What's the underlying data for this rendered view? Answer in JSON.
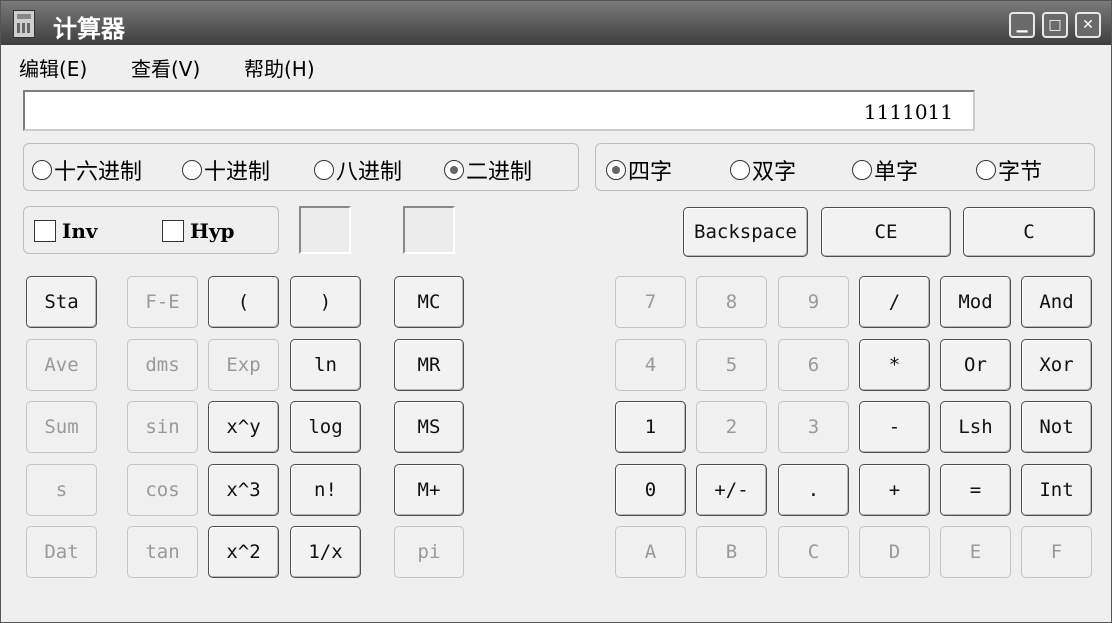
{
  "window": {
    "title": "计算器"
  },
  "menu": [
    "编辑(E)",
    "查看(V)",
    "帮助(H)"
  ],
  "window_controls": [
    "minimize-icon",
    "maximize-icon",
    "close-icon"
  ],
  "display": {
    "value": "1111011"
  },
  "base_modes": [
    {
      "label": "十六进制",
      "checked": false
    },
    {
      "label": "十进制",
      "checked": false
    },
    {
      "label": "八进制",
      "checked": false
    },
    {
      "label": "二进制",
      "checked": true
    }
  ],
  "word_sizes": [
    {
      "label": "四字",
      "checked": true
    },
    {
      "label": "双字",
      "checked": false
    },
    {
      "label": "单字",
      "checked": false
    },
    {
      "label": "字节",
      "checked": false
    }
  ],
  "checkboxes": [
    {
      "label": "Inv",
      "checked": false
    },
    {
      "label": "Hyp",
      "checked": false
    }
  ],
  "edit_keys": [
    "Backspace",
    "CE",
    "C"
  ],
  "keys": {
    "row1": [
      "Sta",
      "F-E",
      "(",
      ")",
      "MC",
      "7",
      "8",
      "9",
      "/",
      "Mod",
      "And"
    ],
    "row2": [
      "Ave",
      "dms",
      "Exp",
      "ln",
      "MR",
      "4",
      "5",
      "6",
      "*",
      "Or",
      "Xor"
    ],
    "row3": [
      "Sum",
      "sin",
      "x^y",
      "log",
      "MS",
      "1",
      "2",
      "3",
      "-",
      "Lsh",
      "Not"
    ],
    "row4": [
      "s",
      "cos",
      "x^3",
      "n!",
      "M+",
      "0",
      "+/-",
      ".",
      "+",
      "=",
      "Int"
    ],
    "row5": [
      "Dat",
      "tan",
      "x^2",
      "1/x",
      "pi",
      "A",
      "B",
      "C",
      "D",
      "E",
      "F"
    ]
  },
  "disabled_keys": {
    "row1": [
      false,
      true,
      false,
      false,
      false,
      true,
      true,
      true,
      false,
      false,
      false
    ],
    "row2": [
      true,
      true,
      true,
      false,
      false,
      true,
      true,
      true,
      false,
      false,
      false
    ],
    "row3": [
      true,
      true,
      false,
      false,
      false,
      false,
      true,
      true,
      false,
      false,
      false
    ],
    "row4": [
      true,
      true,
      false,
      false,
      false,
      false,
      false,
      false,
      false,
      false,
      false
    ],
    "row5": [
      true,
      true,
      false,
      false,
      true,
      true,
      true,
      true,
      true,
      true,
      true
    ]
  },
  "key_names": {
    "row1": [
      "sta",
      "f-e",
      "open-paren",
      "close-paren",
      "mc",
      "7",
      "8",
      "9",
      "divide",
      "mod",
      "and"
    ],
    "row2": [
      "ave",
      "dms",
      "exp",
      "ln",
      "mr",
      "4",
      "5",
      "6",
      "multiply",
      "or",
      "xor"
    ],
    "row3": [
      "sum",
      "sin",
      "x-pow-y",
      "log",
      "ms",
      "1",
      "2",
      "3",
      "minus",
      "lsh",
      "not"
    ],
    "row4": [
      "s",
      "cos",
      "x-cubed",
      "factorial",
      "m-plus",
      "0",
      "sign",
      "decimal",
      "plus",
      "equals",
      "int"
    ],
    "row5": [
      "dat",
      "tan",
      "x-squared",
      "reciprocal",
      "pi",
      "a",
      "b",
      "c",
      "d",
      "e",
      "f"
    ]
  }
}
